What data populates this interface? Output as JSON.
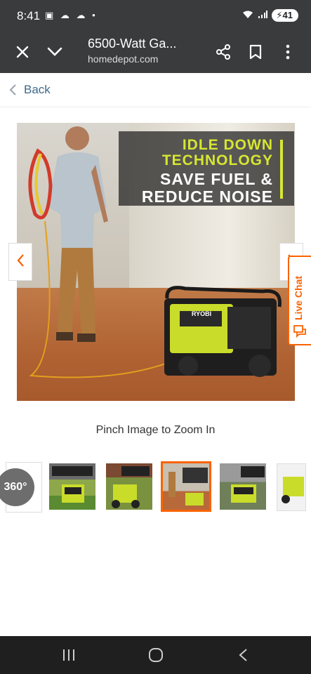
{
  "status_bar": {
    "time": "8:41",
    "battery": "41"
  },
  "app_bar": {
    "title": "6500-Watt Ga...",
    "url": "homedepot.com"
  },
  "back": {
    "label": "Back"
  },
  "hero": {
    "line1": "IDLE DOWN",
    "line2": "TECHNOLOGY",
    "line3": "SAVE FUEL &",
    "line4": "REDUCE NOISE",
    "brand": "RYOBI"
  },
  "live_chat": {
    "label": "Live Chat"
  },
  "zoom_hint": "Pinch Image to Zoom In",
  "thumbnails": {
    "first": "360°",
    "selected_index": 3,
    "count": 6
  },
  "colors": {
    "accent": "#f96302",
    "lime": "#d6e632",
    "bar": "#3a3b3d",
    "link": "#3d6b8c"
  },
  "icons": [
    "close-icon",
    "chevron-down-icon",
    "share-icon",
    "bookmark-icon",
    "more-vert-icon",
    "chevron-left-icon",
    "chevron-right-icon",
    "chat-bubble-icon"
  ]
}
